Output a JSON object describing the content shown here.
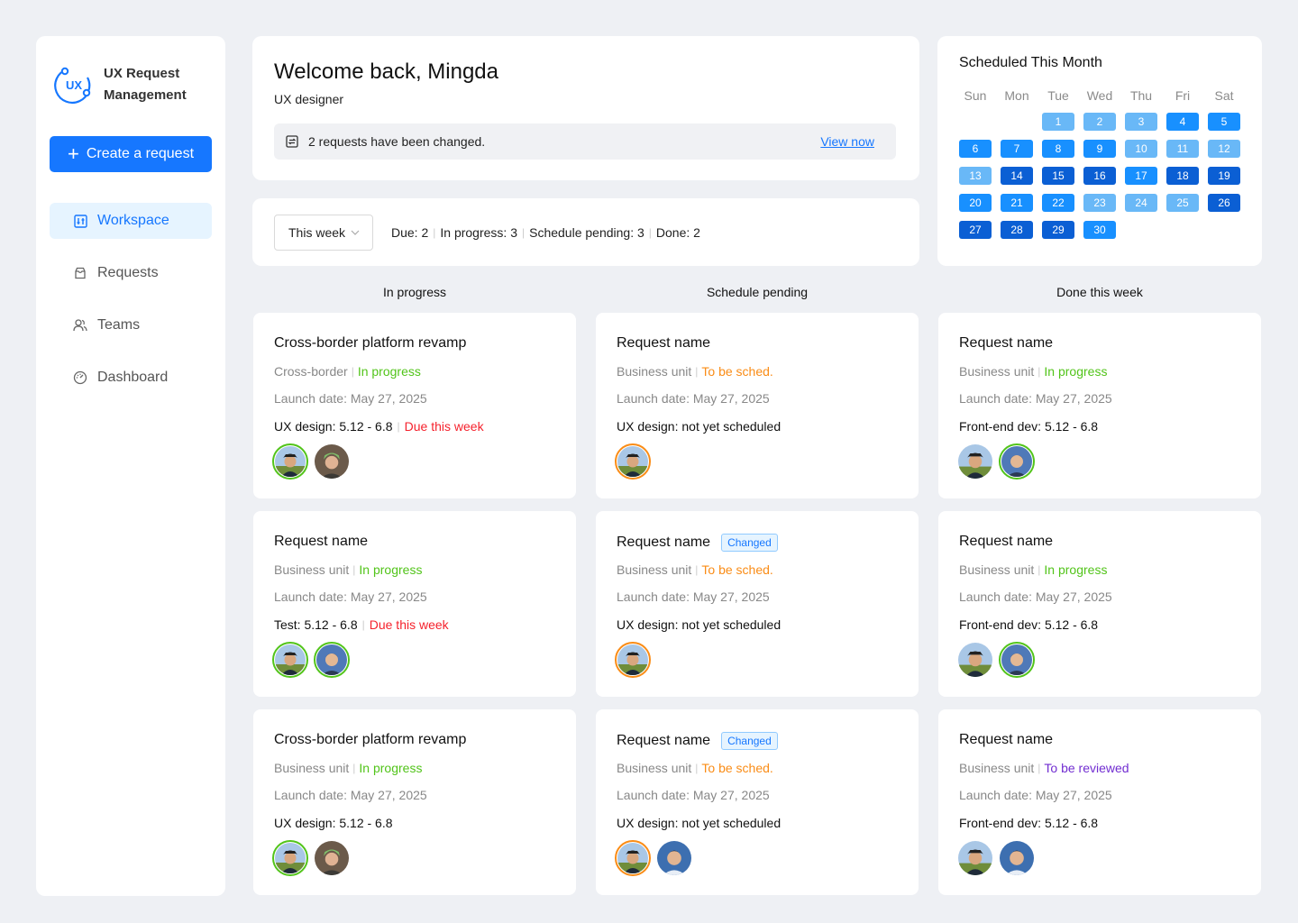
{
  "brand": {
    "line1": "UX Request",
    "line2": "Management",
    "logo_text": "UX",
    "logo_icon": "ux-logo-icon"
  },
  "sidebar": {
    "create_label": "Create a request",
    "items": [
      {
        "label": "Workspace",
        "icon": "workspace-icon",
        "active": true
      },
      {
        "label": "Requests",
        "icon": "requests-icon",
        "active": false
      },
      {
        "label": "Teams",
        "icon": "teams-icon",
        "active": false
      },
      {
        "label": "Dashboard",
        "icon": "dashboard-icon",
        "active": false
      }
    ]
  },
  "welcome": {
    "title": "Welcome back, Mingda",
    "role": "UX designer",
    "notice": "2 requests have been changed.",
    "notice_link": "View now"
  },
  "filter": {
    "period": "This week",
    "stats": [
      "Due: 2",
      "In progress: 3",
      "Schedule pending: 3",
      "Done: 2"
    ]
  },
  "calendar": {
    "title": "Scheduled This Month",
    "weekdays": [
      "Sun",
      "Mon",
      "Tue",
      "Wed",
      "Thu",
      "Fri",
      "Sat"
    ],
    "colors": {
      "light": "#69b8f7",
      "medium": "#1890ff",
      "dark": "#0b5fd4"
    },
    "days": [
      {
        "d": "1",
        "c": "light"
      },
      {
        "d": "2",
        "c": "light"
      },
      {
        "d": "3",
        "c": "light"
      },
      {
        "d": "4",
        "c": "medium"
      },
      {
        "d": "5",
        "c": "medium"
      },
      {
        "d": "6",
        "c": "medium"
      },
      {
        "d": "7",
        "c": "medium"
      },
      {
        "d": "8",
        "c": "medium"
      },
      {
        "d": "9",
        "c": "medium"
      },
      {
        "d": "10",
        "c": "light"
      },
      {
        "d": "11",
        "c": "light"
      },
      {
        "d": "12",
        "c": "light"
      },
      {
        "d": "13",
        "c": "light"
      },
      {
        "d": "14",
        "c": "dark"
      },
      {
        "d": "15",
        "c": "dark"
      },
      {
        "d": "16",
        "c": "dark"
      },
      {
        "d": "17",
        "c": "medium"
      },
      {
        "d": "18",
        "c": "dark"
      },
      {
        "d": "19",
        "c": "dark"
      },
      {
        "d": "20",
        "c": "medium"
      },
      {
        "d": "21",
        "c": "medium"
      },
      {
        "d": "22",
        "c": "medium"
      },
      {
        "d": "23",
        "c": "light"
      },
      {
        "d": "24",
        "c": "light"
      },
      {
        "d": "25",
        "c": "light"
      },
      {
        "d": "26",
        "c": "dark"
      },
      {
        "d": "27",
        "c": "dark"
      },
      {
        "d": "28",
        "c": "dark"
      },
      {
        "d": "29",
        "c": "dark"
      },
      {
        "d": "30",
        "c": "medium"
      }
    ]
  },
  "columns": [
    {
      "title": "In progress",
      "cards": [
        {
          "name": "Cross-border platform revamp",
          "tag": "",
          "unit": "Cross-border",
          "status": "In progress",
          "status_color": "green",
          "launch": "Launch date: May 27, 2025",
          "schedule": "UX design: 5.12 - 6.8",
          "due": "Due this week",
          "avatars": [
            {
              "p": "a",
              "ring": "green"
            },
            {
              "p": "b",
              "ring": ""
            }
          ]
        },
        {
          "name": "Request name",
          "tag": "",
          "unit": "Business unit",
          "status": "In progress",
          "status_color": "green",
          "launch": "Launch date: May 27, 2025",
          "schedule": "Test: 5.12 - 6.8",
          "due": "Due this week",
          "avatars": [
            {
              "p": "a",
              "ring": "green"
            },
            {
              "p": "c",
              "ring": "green"
            }
          ]
        },
        {
          "name": "Cross-border platform revamp",
          "tag": "",
          "unit": "Business unit",
          "status": "In progress",
          "status_color": "green",
          "launch": "Launch date: May 27, 2025",
          "schedule": "UX design: 5.12 - 6.8",
          "due": "",
          "avatars": [
            {
              "p": "a",
              "ring": "green"
            },
            {
              "p": "b",
              "ring": ""
            }
          ]
        }
      ]
    },
    {
      "title": "Schedule pending",
      "cards": [
        {
          "name": "Request name",
          "tag": "",
          "unit": "Business unit",
          "status": "To be sched.",
          "status_color": "orange",
          "launch": "Launch date: May 27, 2025",
          "schedule": "UX design: not yet scheduled",
          "due": "",
          "avatars": [
            {
              "p": "a",
              "ring": "orange"
            }
          ]
        },
        {
          "name": "Request name",
          "tag": "Changed",
          "unit": "Business unit",
          "status": "To be sched.",
          "status_color": "orange",
          "launch": "Launch date: May 27, 2025",
          "schedule": "UX design: not yet scheduled",
          "due": "",
          "avatars": [
            {
              "p": "a",
              "ring": "orange"
            }
          ]
        },
        {
          "name": "Request name",
          "tag": "Changed",
          "unit": "Business unit",
          "status": "To be sched.",
          "status_color": "orange",
          "launch": "Launch date: May 27, 2025",
          "schedule": "UX design: not yet scheduled",
          "due": "",
          "avatars": [
            {
              "p": "a",
              "ring": "orange"
            },
            {
              "p": "d",
              "ring": ""
            }
          ]
        }
      ]
    },
    {
      "title": "Done this week",
      "cards": [
        {
          "name": "Request name",
          "tag": "",
          "unit": "Business unit",
          "status": "In progress",
          "status_color": "green",
          "launch": "Launch date: May 27, 2025",
          "schedule": "Front-end dev: 5.12 - 6.8",
          "due": "",
          "avatars": [
            {
              "p": "a",
              "ring": ""
            },
            {
              "p": "c",
              "ring": "green"
            }
          ]
        },
        {
          "name": "Request name",
          "tag": "",
          "unit": "Business unit",
          "status": "In progress",
          "status_color": "green",
          "launch": "Launch date: May 27, 2025",
          "schedule": "Front-end dev: 5.12 - 6.8",
          "due": "",
          "avatars": [
            {
              "p": "a",
              "ring": ""
            },
            {
              "p": "c",
              "ring": "green"
            }
          ]
        },
        {
          "name": "Request name",
          "tag": "",
          "unit": "Business unit",
          "status": "To be reviewed",
          "status_color": "purple",
          "launch": "Launch date: May 27, 2025",
          "schedule": "Front-end dev: 5.12 - 6.8",
          "due": "",
          "avatars": [
            {
              "p": "a",
              "ring": ""
            },
            {
              "p": "d",
              "ring": ""
            }
          ]
        }
      ]
    }
  ]
}
